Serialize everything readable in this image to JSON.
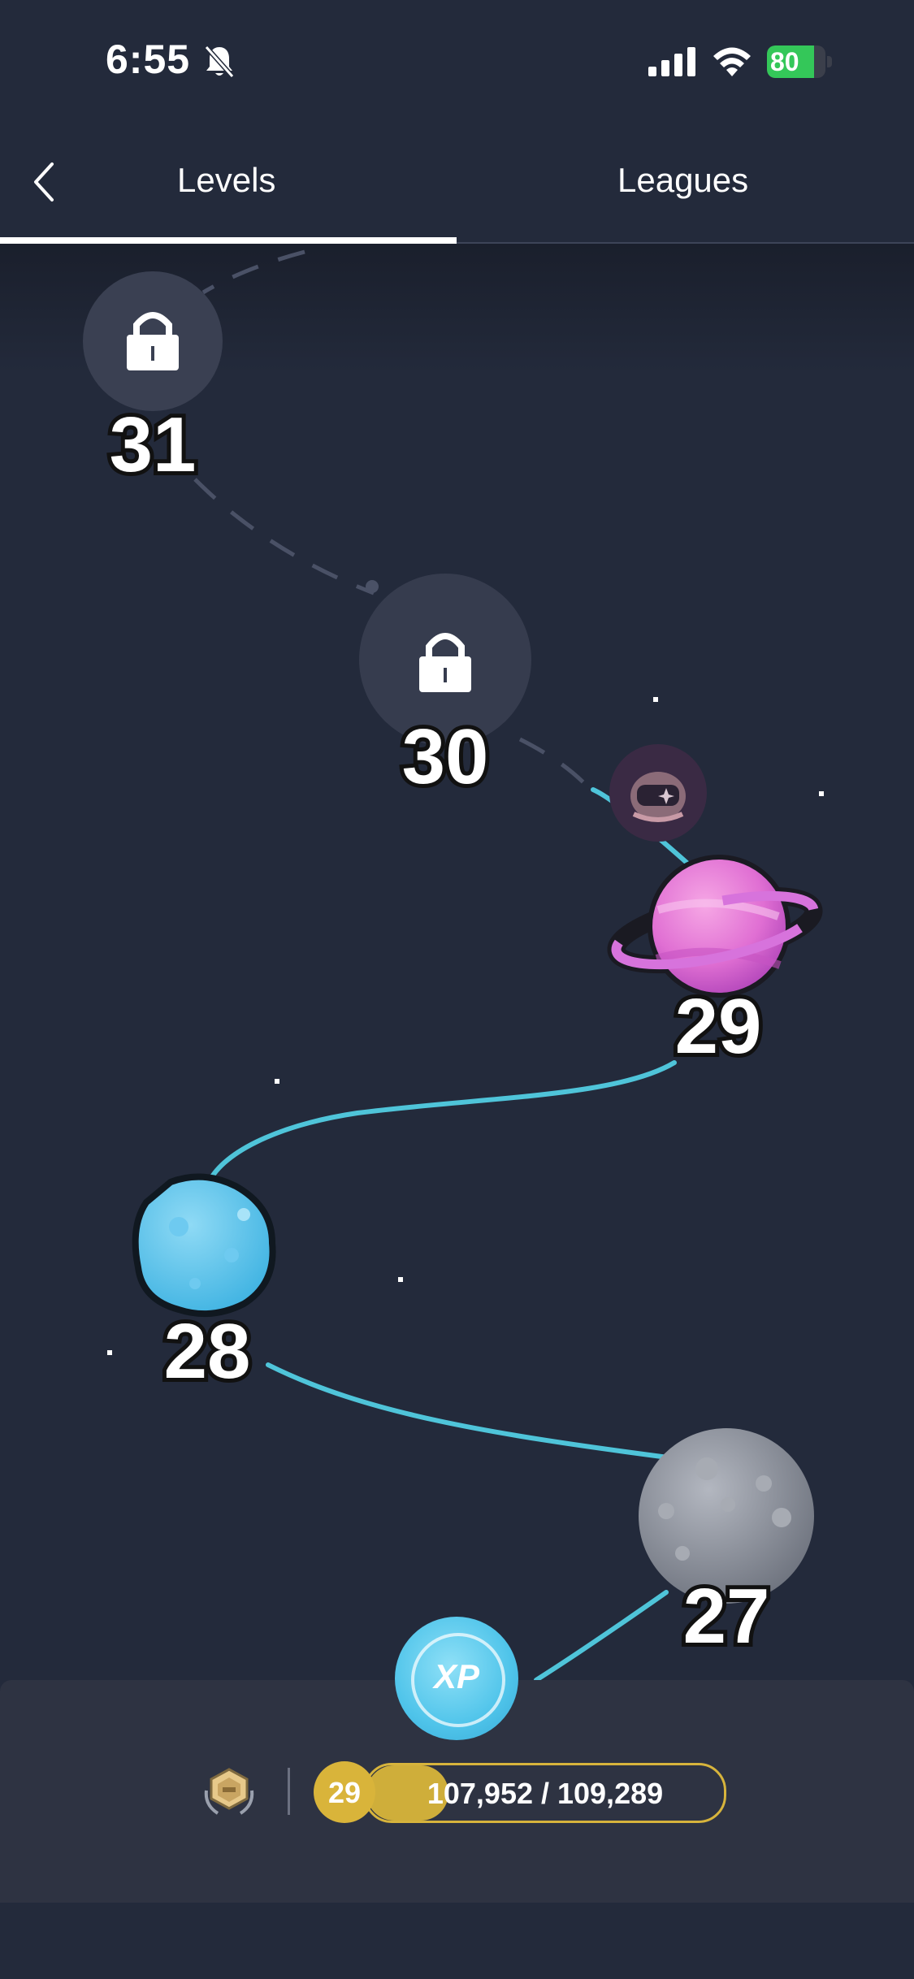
{
  "status_bar": {
    "time": "6:55",
    "battery_percent": "80",
    "battery_level": 0.8,
    "icons": [
      "bell-slash-icon",
      "signal-icon",
      "wifi-icon",
      "battery-charging-icon"
    ]
  },
  "tabs": [
    {
      "label": "Levels",
      "active": true
    },
    {
      "label": "Leagues",
      "active": false
    }
  ],
  "levels": [
    {
      "number": "31",
      "state": "locked"
    },
    {
      "number": "30",
      "state": "locked"
    },
    {
      "number": "29",
      "state": "current",
      "planet": "ringed-pink"
    },
    {
      "number": "28",
      "state": "complete",
      "planet": "blue-rock"
    },
    {
      "number": "27",
      "state": "complete",
      "planet": "gray-moon"
    }
  ],
  "footer": {
    "xp_label": "XP",
    "current_level": "29",
    "progress_text": "107,952 / 109,289",
    "progress_fraction": 0.23
  },
  "colors": {
    "background": "#232a3b",
    "path": "#4fc4d9",
    "gold": "#d7b43c",
    "battery": "#34c759"
  }
}
